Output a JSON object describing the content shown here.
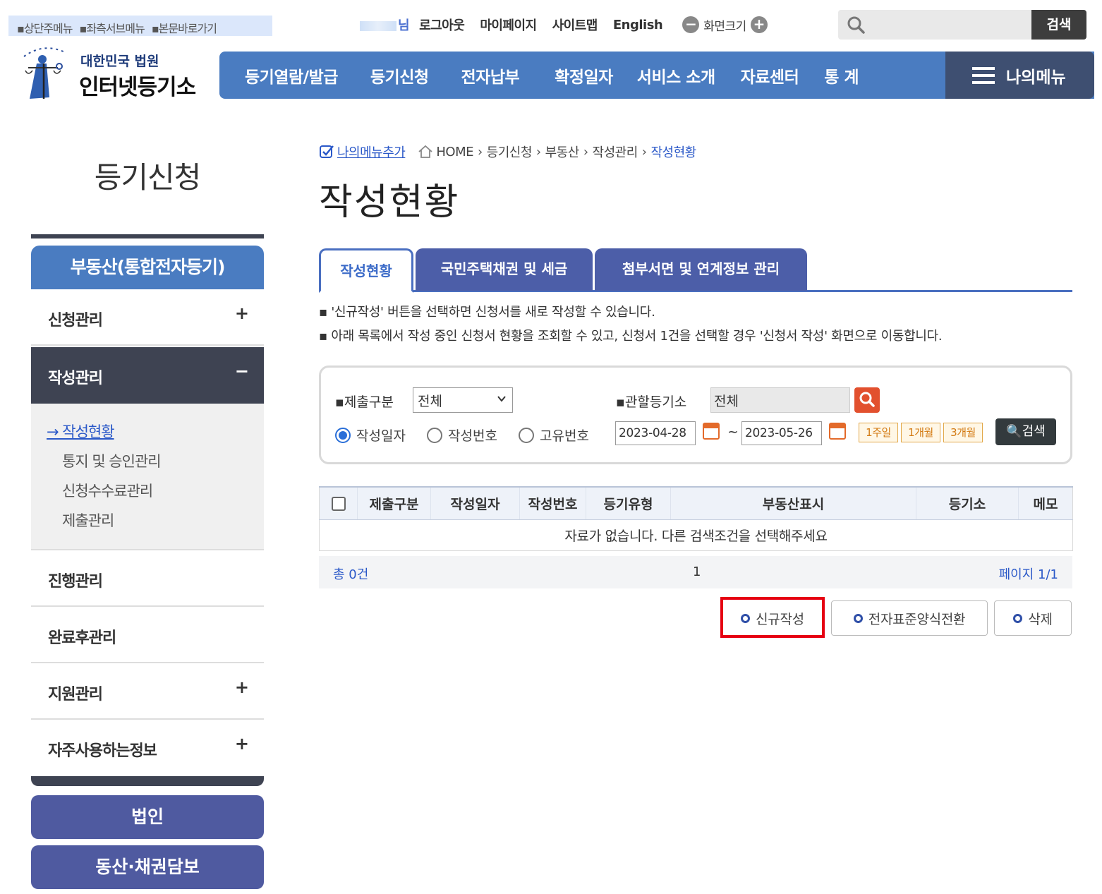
{
  "skip_links": [
    "▪상단주메뉴",
    "▪좌측서브메뉴",
    "▪본문바로가기"
  ],
  "util": {
    "user_suffix": "님",
    "logout": "로그아웃",
    "mypage": "마이페이지",
    "sitemap": "사이트맵",
    "english": "English",
    "zoom_label": "화면크기",
    "zoom_out": "−",
    "zoom_in": "+"
  },
  "top_search": {
    "placeholder": "",
    "button": "검색"
  },
  "logo": {
    "sub": "대한민국 법원",
    "main": "인터넷등기소"
  },
  "gnb": {
    "items": [
      "등기열람/발급",
      "등기신청",
      "전자납부",
      "확정일자",
      "서비스 소개",
      "자료센터",
      "통 계"
    ],
    "mymenu": "나의메뉴"
  },
  "sidebar": {
    "title": "등기신청",
    "category": "부동산(통합전자등기)",
    "items": [
      {
        "label": "신청관리",
        "toggle": "+"
      },
      {
        "label": "작성관리",
        "toggle": "−"
      },
      {
        "label": "진행관리",
        "toggle": ""
      },
      {
        "label": "완료후관리",
        "toggle": ""
      },
      {
        "label": "지원관리",
        "toggle": "+"
      },
      {
        "label": "자주사용하는정보",
        "toggle": "+"
      }
    ],
    "sub_items": [
      "→ 작성현황",
      "통지 및 승인관리",
      "신청수수료관리",
      "제출관리"
    ],
    "bottom_buttons": [
      "법인",
      "동산·채권담보"
    ]
  },
  "breadcrumb": {
    "add_menu": "나의메뉴추가",
    "path": [
      "HOME",
      "등기신청",
      "부동산",
      "작성관리",
      "작성현황"
    ]
  },
  "page_title": "작성현황",
  "tabs": [
    "작성현황",
    "국민주택채권 및 세금",
    "첨부서면 및 연계정보 관리"
  ],
  "info": [
    "▪ '신규작성' 버튼을 선택하면 신청서를 새로 작성할 수 있습니다.",
    "▪ 아래 목록에서 작성 중인 신청서 현황을 조회할 수 있고, 신청서 1건을 선택할 경우 '신청서 작성' 화면으로 이동합니다."
  ],
  "search": {
    "submit_type_label": "▪제출구분",
    "submit_type_value": "전체",
    "office_label": "▪관할등기소",
    "office_value": "전체",
    "radios": [
      "작성일자",
      "작성번호",
      "고유번호"
    ],
    "date_from": "2023-04-28",
    "tilde": "~",
    "date_to": "2023-05-26",
    "quick": [
      "1주일",
      "1개월",
      "3개월"
    ],
    "button": "검색"
  },
  "table": {
    "headers": [
      "제출구분",
      "작성일자",
      "작성번호",
      "등기유형",
      "부동산표시",
      "등기소",
      "메모"
    ],
    "empty": "자료가 없습니다. 다른 검색조건을 선택해주세요"
  },
  "pager": {
    "total": "총 0건",
    "page": "1",
    "info": "페이지 1/1"
  },
  "actions": [
    "신규작성",
    "전자표준양식전환",
    "삭제"
  ],
  "colors": {
    "nav": "#4a7cc1",
    "nav_dark": "#3e4f71",
    "sidebar_dark": "#3e4352",
    "tab": "#4c5ea8",
    "highlight": "#e60012"
  }
}
